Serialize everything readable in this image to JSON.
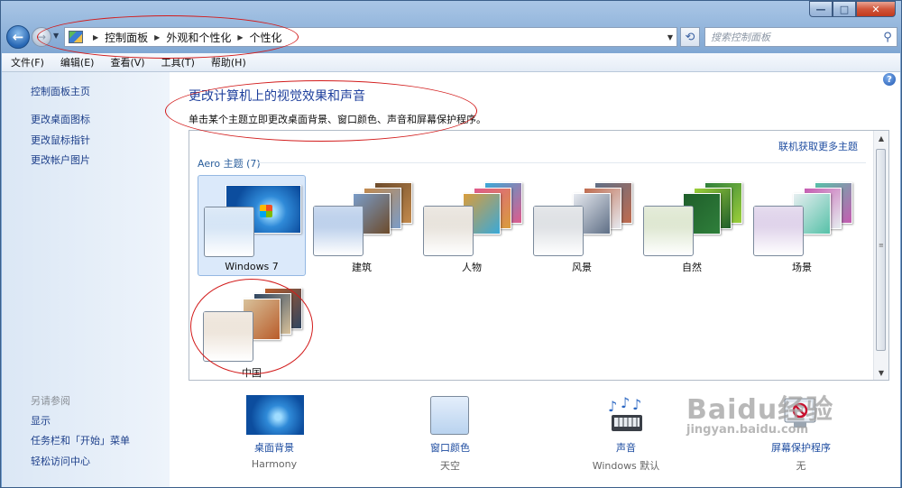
{
  "window": {
    "caption_min": "—",
    "caption_max": "□",
    "caption_close": "✕"
  },
  "address_bar": {
    "breadcrumbs": [
      "控制面板",
      "外观和个性化",
      "个性化"
    ],
    "search_placeholder": "搜索控制面板"
  },
  "menu": [
    "文件(F)",
    "编辑(E)",
    "查看(V)",
    "工具(T)",
    "帮助(H)"
  ],
  "sidebar": {
    "links": [
      "控制面板主页",
      "更改桌面图标",
      "更改鼠标指针",
      "更改帐户图片"
    ],
    "see_also_heading": "另请参阅",
    "see_also": [
      "显示",
      "任务栏和「开始」菜单",
      "轻松访问中心"
    ]
  },
  "main": {
    "title": "更改计算机上的视觉效果和声音",
    "subtitle": "单击某个主题立即更改桌面背景、窗口颜色、声音和屏幕保护程序。",
    "online_link": "联机获取更多主题",
    "group_label": "Aero 主题 (7)",
    "themes": [
      {
        "name": "Windows 7",
        "selected": true,
        "glass": "#b9d3ef"
      },
      {
        "name": "建筑",
        "selected": false,
        "glass": "#8fb0de",
        "colors": [
          "#6d4b2b",
          "#c38a4d",
          "#7a9cc8"
        ]
      },
      {
        "name": "人物",
        "selected": false,
        "glass": "#d8d0c4",
        "colors": [
          "#3aa9d8",
          "#e05a8c",
          "#d99d3c"
        ]
      },
      {
        "name": "风景",
        "selected": false,
        "glass": "#c8ccd2",
        "colors": [
          "#5f6f86",
          "#c06b4e",
          "#e6e9ef"
        ]
      },
      {
        "name": "自然",
        "selected": false,
        "glass": "#c8d7b2",
        "colors": [
          "#2f7f3b",
          "#9ccf3a",
          "#1f5e2a"
        ]
      },
      {
        "name": "场景",
        "selected": false,
        "glass": "#c9b5dc",
        "colors": [
          "#56c1a8",
          "#c65bb1",
          "#e6eef0"
        ]
      },
      {
        "name": "中国",
        "selected": false,
        "glass": "#e2d3c2",
        "colors": [
          "#b95c2a",
          "#2e4560",
          "#d8c19a"
        ]
      }
    ]
  },
  "bottom": [
    {
      "label": "桌面背景",
      "value": "Harmony"
    },
    {
      "label": "窗口颜色",
      "value": "天空"
    },
    {
      "label": "声音",
      "value": "Windows 默认"
    },
    {
      "label": "屏幕保护程序",
      "value": "无"
    }
  ],
  "help_icon": "?",
  "watermark": {
    "main": "Baidu经验",
    "sub": "jingyan.baidu.com"
  },
  "colors": {
    "link": "#1e4ca0",
    "title": "#1e3f9c",
    "annotation": "#d21b1b",
    "sidebar_bg": "#dbe7f5"
  }
}
